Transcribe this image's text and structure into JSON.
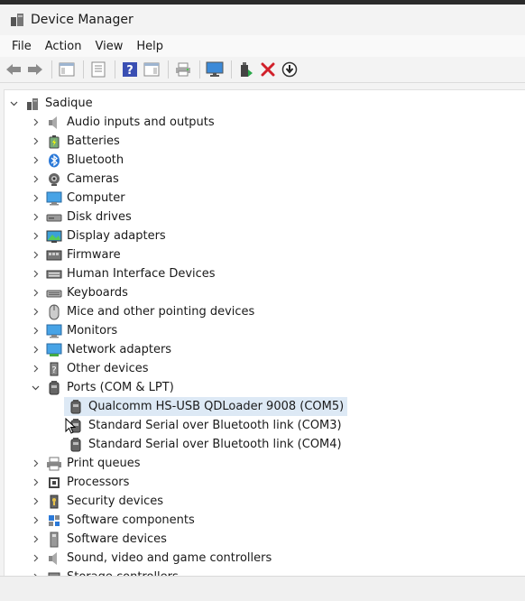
{
  "window": {
    "title": "Device Manager"
  },
  "menu": [
    "File",
    "Action",
    "View",
    "Help"
  ],
  "tree": {
    "root": "Sadique",
    "categories": [
      {
        "label": "Audio inputs and outputs",
        "icon": "speaker-icon"
      },
      {
        "label": "Batteries",
        "icon": "battery-icon"
      },
      {
        "label": "Bluetooth",
        "icon": "bluetooth-icon"
      },
      {
        "label": "Cameras",
        "icon": "camera-icon"
      },
      {
        "label": "Computer",
        "icon": "computer-icon"
      },
      {
        "label": "Disk drives",
        "icon": "disk-drive-icon"
      },
      {
        "label": "Display adapters",
        "icon": "display-adapter-icon"
      },
      {
        "label": "Firmware",
        "icon": "firmware-icon"
      },
      {
        "label": "Human Interface Devices",
        "icon": "hid-icon"
      },
      {
        "label": "Keyboards",
        "icon": "keyboard-icon"
      },
      {
        "label": "Mice and other pointing devices",
        "icon": "mouse-icon"
      },
      {
        "label": "Monitors",
        "icon": "monitor-icon"
      },
      {
        "label": "Network adapters",
        "icon": "network-adapter-icon"
      },
      {
        "label": "Other devices",
        "icon": "other-devices-icon"
      },
      {
        "label": "Ports (COM & LPT)",
        "icon": "port-icon",
        "expanded": true,
        "children": [
          {
            "label": "Qualcomm HS-USB QDLoader 9008 (COM5)",
            "selected": true
          },
          {
            "label": "Standard Serial over Bluetooth link (COM3)"
          },
          {
            "label": "Standard Serial over Bluetooth link (COM4)"
          }
        ]
      },
      {
        "label": "Print queues",
        "icon": "printer-icon"
      },
      {
        "label": "Processors",
        "icon": "processor-icon"
      },
      {
        "label": "Security devices",
        "icon": "security-icon"
      },
      {
        "label": "Software components",
        "icon": "software-component-icon"
      },
      {
        "label": "Software devices",
        "icon": "software-device-icon"
      },
      {
        "label": "Sound, video and game controllers",
        "icon": "sound-icon"
      },
      {
        "label": "Storage controllers",
        "icon": "storage-controller-icon"
      }
    ]
  },
  "colors": {
    "selection": "#dde9f5",
    "accent": "#2b79d8",
    "uninstall_red": "#d1202a"
  }
}
